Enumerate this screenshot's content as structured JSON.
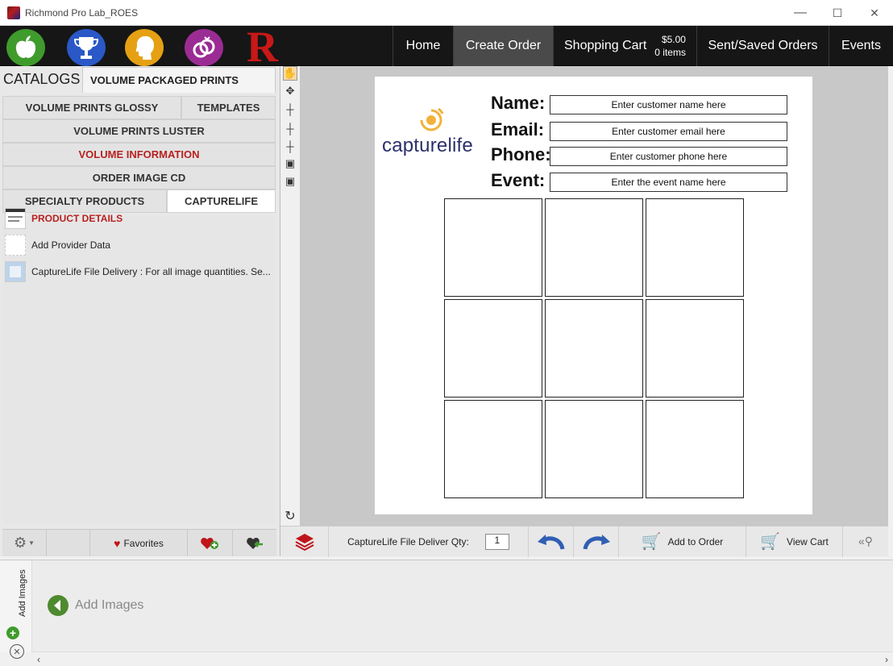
{
  "window": {
    "title": "Richmond Pro Lab_ROES",
    "minimize": "—",
    "maximize": "☐",
    "close": "✕"
  },
  "nav": {
    "brand_letter": "R",
    "items": [
      {
        "label": "Home"
      },
      {
        "label": "Create Order"
      },
      {
        "label": "Shopping Cart"
      },
      {
        "label": "Sent/Saved Orders"
      },
      {
        "label": "Events"
      }
    ],
    "cart_price": "$5.00",
    "cart_items": "0 items",
    "icon_colors": [
      "#3f9b2c",
      "#2a58c7",
      "#e5a113",
      "#9b2c94"
    ]
  },
  "catalogs": {
    "label": "CATALOGS",
    "top_tab": "VOLUME PACKAGED PRINTS",
    "rows": [
      [
        "VOLUME PRINTS GLOSSY",
        "TEMPLATES"
      ],
      [
        "VOLUME PRINTS LUSTER"
      ],
      [
        "VOLUME INFORMATION"
      ],
      [
        "ORDER IMAGE CD"
      ],
      [
        "SPECIALTY PRODUCTS",
        "CAPTURELIFE"
      ]
    ]
  },
  "products": [
    {
      "label": "PRODUCT DETAILS"
    },
    {
      "label": "Add Provider Data"
    },
    {
      "label": "CaptureLife File Delivery : For all image quantities. Se..."
    }
  ],
  "left_toolbar": {
    "favorites": "Favorites"
  },
  "template": {
    "brand": "capturelife",
    "fields": [
      {
        "label": "Name:",
        "placeholder": "Enter customer name here"
      },
      {
        "label": "Email:",
        "placeholder": "Enter customer email here"
      },
      {
        "label": "Phone:",
        "placeholder": "Enter customer phone here"
      },
      {
        "label": "Event:",
        "placeholder": "Enter the event name here"
      }
    ],
    "grid_rows": 3,
    "grid_cols": 3
  },
  "canvas_toolbar": {
    "qty_label": "CaptureLife File Deliver Qty:",
    "qty_value": "1",
    "add_to_order": "Add to Order",
    "view_cart": "View Cart"
  },
  "tray": {
    "vertical_label": "Add Images",
    "add_images": "Add Images"
  }
}
